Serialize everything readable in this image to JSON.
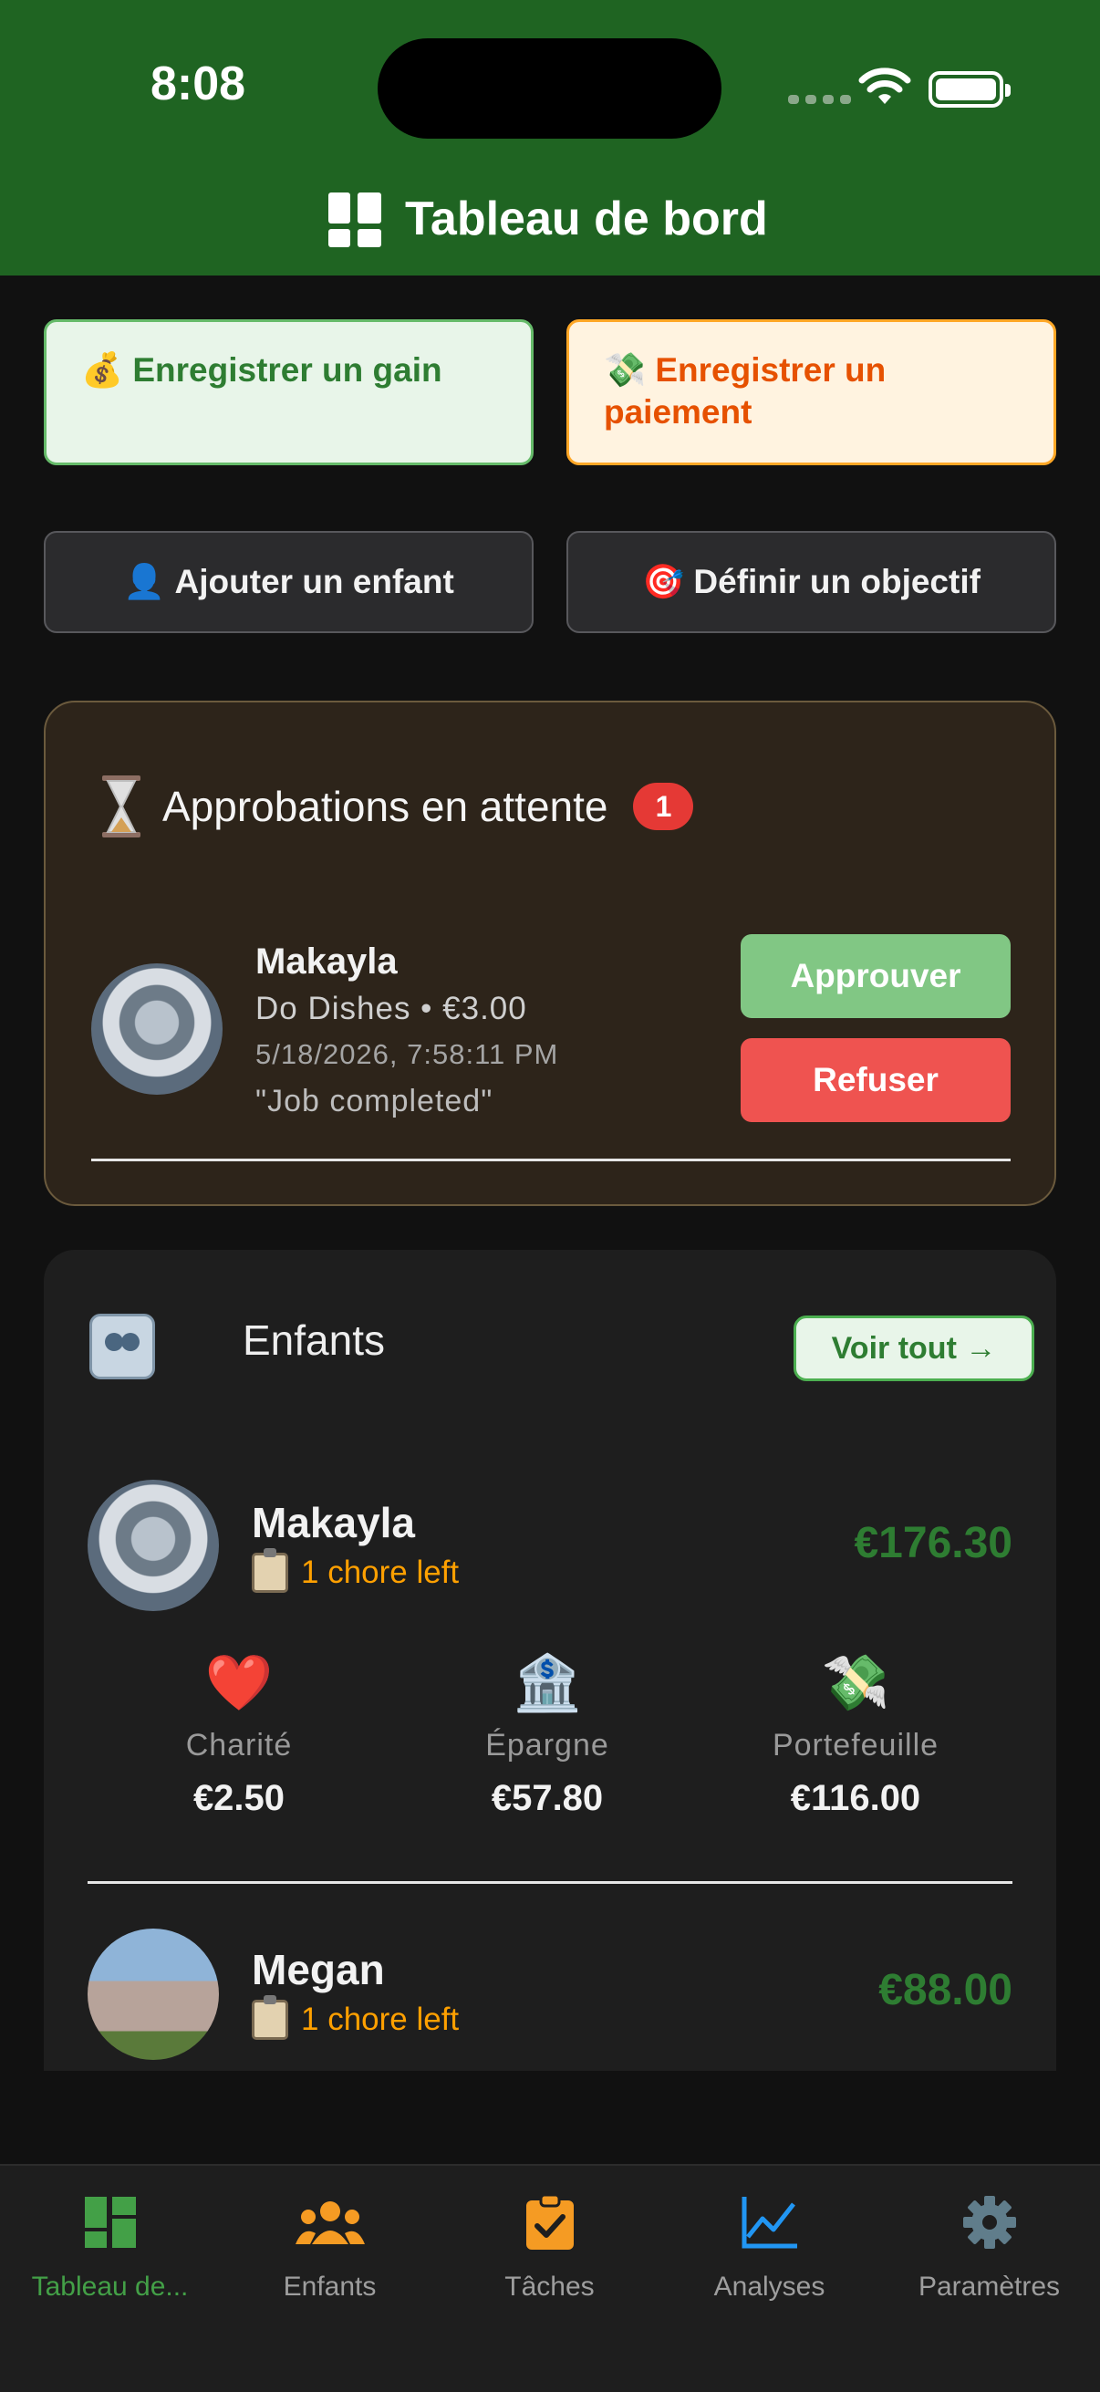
{
  "status_bar": {
    "time": "8:08"
  },
  "header": {
    "title": "Tableau de bord",
    "icon": "dashboard-icon"
  },
  "quick_actions": {
    "record_gain": {
      "emoji": "💰",
      "label": "Enregistrer un gain"
    },
    "record_payment": {
      "emoji": "💸",
      "label": "Enregistrer un paiement"
    },
    "add_child": {
      "emoji": "👤",
      "label": "Ajouter un enfant"
    },
    "set_goal": {
      "emoji": "🎯",
      "label": "Définir un objectif"
    }
  },
  "pending": {
    "title": "Approbations en attente",
    "count": "1",
    "request": {
      "name": "Makayla",
      "detail": "Do Dishes • €3.00",
      "date": "5/18/2026, 7:58:11 PM",
      "note": "\"Job completed\"",
      "approve_label": "Approuver",
      "refuse_label": "Refuser"
    }
  },
  "children": {
    "title": "Enfants",
    "see_all": "Voir tout →",
    "items": [
      {
        "name": "Makayla",
        "chores": "1 chore left",
        "balance": "€176.30",
        "buckets": [
          {
            "icon": "❤️",
            "label": "Charité",
            "value": "€2.50"
          },
          {
            "icon": "🏦",
            "label": "Épargne",
            "value": "€57.80"
          },
          {
            "icon": "💸",
            "label": "Portefeuille",
            "value": "€116.00"
          }
        ]
      },
      {
        "name": "Megan",
        "chores": "1 chore left",
        "balance": "€88.00"
      }
    ]
  },
  "tabs": [
    {
      "label": "Tableau de...",
      "icon": "dashboard-icon",
      "active": true
    },
    {
      "label": "Enfants",
      "icon": "people-icon",
      "active": false
    },
    {
      "label": "Tâches",
      "icon": "clipboard-check-icon",
      "active": false
    },
    {
      "label": "Analyses",
      "icon": "chart-line-icon",
      "active": false
    },
    {
      "label": "Paramètres",
      "icon": "gear-icon",
      "active": false
    }
  ],
  "colors": {
    "header_bg": "#1f6422",
    "accent_green": "#43a047",
    "approve": "#81c784",
    "refuse": "#ef5350",
    "chores": "#ffa000"
  }
}
